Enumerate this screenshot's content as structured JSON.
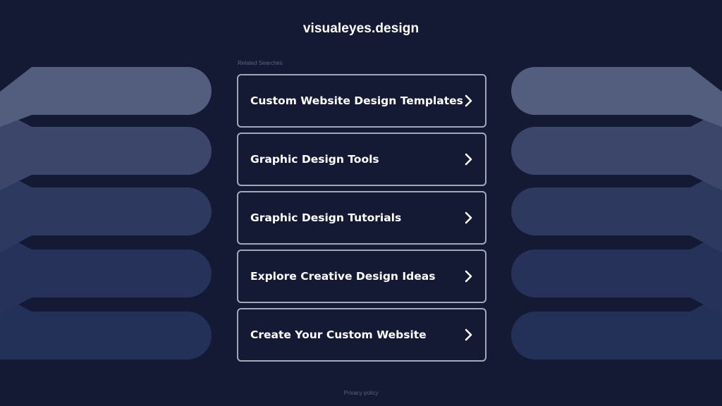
{
  "header": {
    "site_title": "visualeyes.design"
  },
  "related_searches": {
    "label": "Related Searches",
    "items": [
      {
        "label": "Custom Website Design Templates",
        "icon": "chevron-right-icon"
      },
      {
        "label": "Graphic Design Tools",
        "icon": "chevron-right-icon"
      },
      {
        "label": "Graphic Design Tutorials",
        "icon": "chevron-right-icon"
      },
      {
        "label": "Explore Creative Design Ideas",
        "icon": "chevron-right-icon"
      },
      {
        "label": "Create Your Custom Website",
        "icon": "chevron-right-icon"
      }
    ]
  },
  "footer": {
    "privacy_label": "Privacy policy"
  },
  "colors": {
    "background": "#141a33",
    "card_border": "#a3a8b8",
    "text": "#ffffff",
    "muted_text": "#5a6282",
    "deco_shades": [
      "#535d7e",
      "#3c466a",
      "#2e3960",
      "#27325a",
      "#233058"
    ]
  }
}
